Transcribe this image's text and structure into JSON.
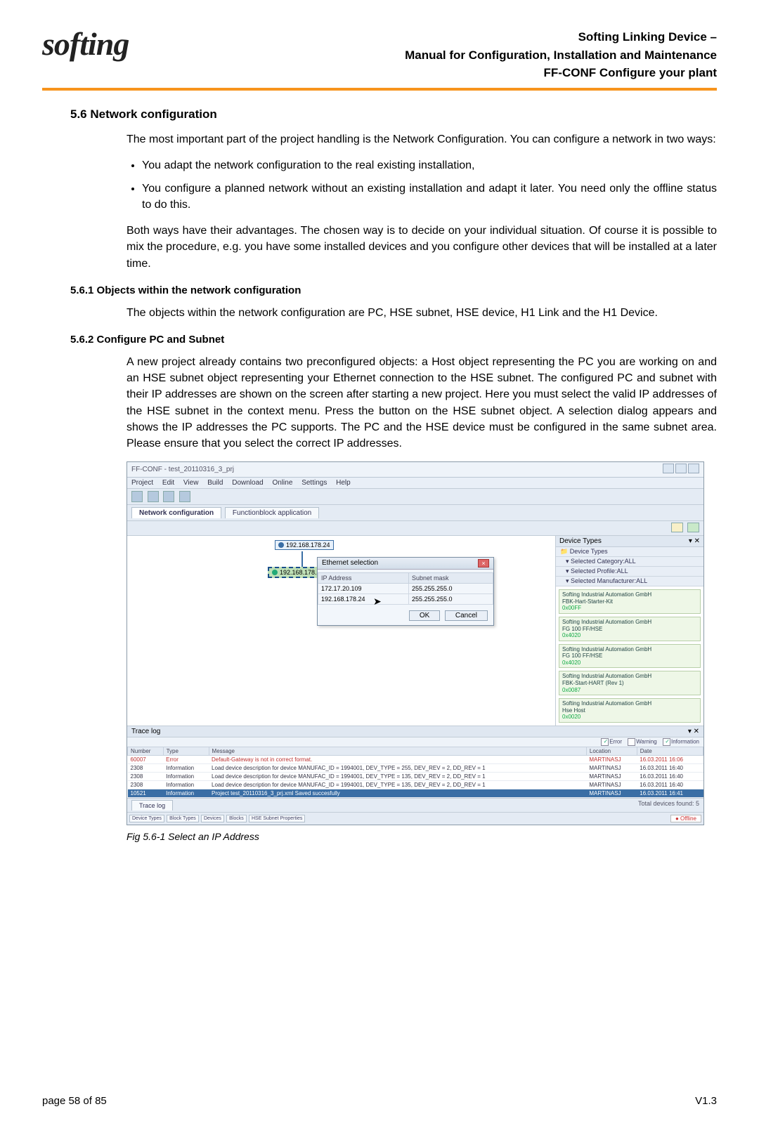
{
  "header": {
    "line1": "Softing Linking Device –",
    "line2": "Manual for Configuration, Installation and Maintenance",
    "line3": "FF-CONF Configure your plant",
    "logo_text": "softing"
  },
  "section": {
    "num_title": "5.6  Network configuration",
    "intro": "The most important part of the project handling is the Network Configuration. You can configure a network in two ways:",
    "bullet1": "You adapt the network configuration to the real existing installation,",
    "bullet2": "You configure a planned network without an existing installation and adapt it later. You need only the offline status to do this.",
    "para2": "Both ways have their advantages. The chosen way is to decide on your individual situation. Of course it is possible to mix the procedure, e.g. you have some installed devices and you configure other devices that will be installed at a later time.",
    "sub1_title": "5.6.1  Objects within the network configuration",
    "sub1_body": "The objects within the network configuration are PC, HSE subnet, HSE device, H1 Link and the H1 Device.",
    "sub2_title": "5.6.2  Configure PC and Subnet",
    "sub2_body": "A new project already contains two preconfigured objects: a Host object representing the PC you are working on and an HSE subnet object representing your Ethernet connection to the HSE subnet. The configured PC and subnet with their IP addresses are shown on the screen after starting a new project. Here you must select the valid IP addresses of the HSE subnet in the context menu. Press the button on the HSE subnet object. A selection dialog appears and shows the IP addresses the PC supports. The PC and the HSE device must be configured in the same subnet area. Please ensure that you select the correct IP addresses."
  },
  "window": {
    "title": "FF-CONF - test_20110316_3_prj",
    "menu": [
      "Project",
      "Edit",
      "View",
      "Build",
      "Download",
      "Online",
      "Settings",
      "Help"
    ],
    "tabs": {
      "active": "Network configuration",
      "other": "Functionblock application"
    },
    "canvas": {
      "pc_ip": "192.168.178.24",
      "subnet_ip": "192.168.178.24"
    },
    "dialog": {
      "title": "Ethernet selection",
      "col1": "IP Address",
      "col2": "Subnet mask",
      "rows": [
        {
          "ip": "172.17.20.109",
          "mask": "255.255.255.0"
        },
        {
          "ip": "192.168.178.24",
          "mask": "255.255.255.0"
        }
      ],
      "ok": "OK",
      "cancel": "Cancel"
    },
    "devtypes": {
      "title": "Device Types",
      "root": "Device Types",
      "filters": {
        "cat": "Selected Category:ALL",
        "prof": "Selected Profile:ALL",
        "man": "Selected Manufacturer:ALL"
      },
      "cards": [
        {
          "l1": "Softing Industrial Automation GmbH",
          "l2": "FBK-Hart-Starter-Kit",
          "l3": "0x00FF"
        },
        {
          "l1": "Softing Industrial Automation GmbH",
          "l2": "FG 100 FF/HSE",
          "l3": "0x4020"
        },
        {
          "l1": "Softing Industrial Automation GmbH",
          "l2": "FG 100 FF/HSE",
          "l3": "0x4020"
        },
        {
          "l1": "Softing Industrial Automation GmbH",
          "l2": "FBK-Start-HART (Rev 1)",
          "l3": "0x0087"
        },
        {
          "l1": "Softing Industrial Automation GmbH",
          "l2": "Hse Host",
          "l3": "0x0020"
        }
      ],
      "total": "Total devices found: 5",
      "btabs": [
        "Device Types",
        "Block Types",
        "Devices",
        "Blocks",
        "HSE Subnet Properties"
      ]
    },
    "trace": {
      "title": "Trace log",
      "filters": {
        "err": "Error",
        "warn": "Warning",
        "info": "Information"
      },
      "cols": [
        "Number",
        "Type",
        "Message",
        "Location",
        "Date"
      ],
      "rows": [
        {
          "n": "60007",
          "t": "Error",
          "m": "Default-Gateway is not in correct format.",
          "l": "MARTINASJ",
          "d": "16.03.2011 16:06"
        },
        {
          "n": "2308",
          "t": "Information",
          "m": "Load device description for device MANUFAC_ID = 1994001, DEV_TYPE = 255, DEV_REV = 2, DD_REV = 1",
          "l": "MARTINASJ",
          "d": "16.03.2011 16:40"
        },
        {
          "n": "2308",
          "t": "Information",
          "m": "Load device description for device MANUFAC_ID = 1994001, DEV_TYPE = 135, DEV_REV = 2, DD_REV = 1",
          "l": "MARTINASJ",
          "d": "16.03.2011 16:40"
        },
        {
          "n": "2308",
          "t": "Information",
          "m": "Load device description for device MANUFAC_ID = 1994001, DEV_TYPE = 135, DEV_REV = 2, DD_REV = 1",
          "l": "MARTINASJ",
          "d": "16.03.2011 16:40"
        },
        {
          "n": "10521",
          "t": "Information",
          "m": "Project  test_20110316_3_prj.xml Saved succesfully",
          "l": "MARTINASJ",
          "d": "16.03.2011 16:41"
        }
      ],
      "tab": "Trace log",
      "status": "Offline"
    }
  },
  "caption": "Fig 5.6-1  Select an IP Address",
  "footer": {
    "left": "page 58 of 85",
    "right": "V1.3"
  }
}
